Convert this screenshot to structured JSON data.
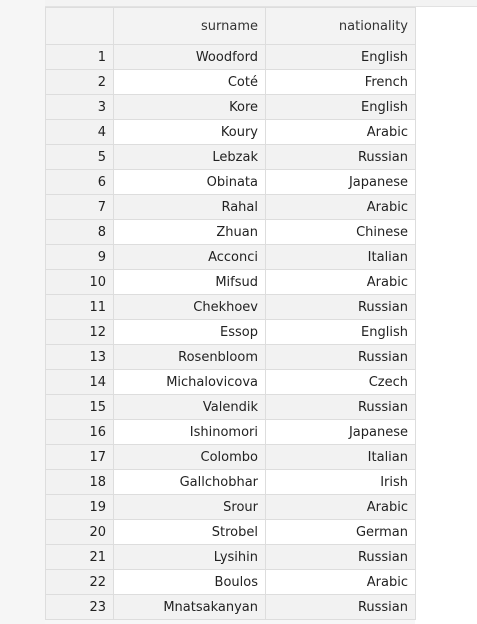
{
  "table": {
    "columns": [
      "",
      "surname",
      "nationality"
    ],
    "rows": [
      [
        "1",
        "Woodford",
        "English"
      ],
      [
        "2",
        "Coté",
        "French"
      ],
      [
        "3",
        "Kore",
        "English"
      ],
      [
        "4",
        "Koury",
        "Arabic"
      ],
      [
        "5",
        "Lebzak",
        "Russian"
      ],
      [
        "6",
        "Obinata",
        "Japanese"
      ],
      [
        "7",
        "Rahal",
        "Arabic"
      ],
      [
        "8",
        "Zhuan",
        "Chinese"
      ],
      [
        "9",
        "Acconci",
        "Italian"
      ],
      [
        "10",
        "Mifsud",
        "Arabic"
      ],
      [
        "11",
        "Chekhoev",
        "Russian"
      ],
      [
        "12",
        "Essop",
        "English"
      ],
      [
        "13",
        "Rosenbloom",
        "Russian"
      ],
      [
        "14",
        "Michalovicova",
        "Czech"
      ],
      [
        "15",
        "Valendik",
        "Russian"
      ],
      [
        "16",
        "Ishinomori",
        "Japanese"
      ],
      [
        "17",
        "Colombo",
        "Italian"
      ],
      [
        "18",
        "Gallchobhar",
        "Irish"
      ],
      [
        "19",
        "Srour",
        "Arabic"
      ],
      [
        "20",
        "Strobel",
        "German"
      ],
      [
        "21",
        "Lysihin",
        "Russian"
      ],
      [
        "22",
        "Boulos",
        "Arabic"
      ],
      [
        "23",
        "Mnatsakanyan",
        "Russian"
      ]
    ]
  }
}
